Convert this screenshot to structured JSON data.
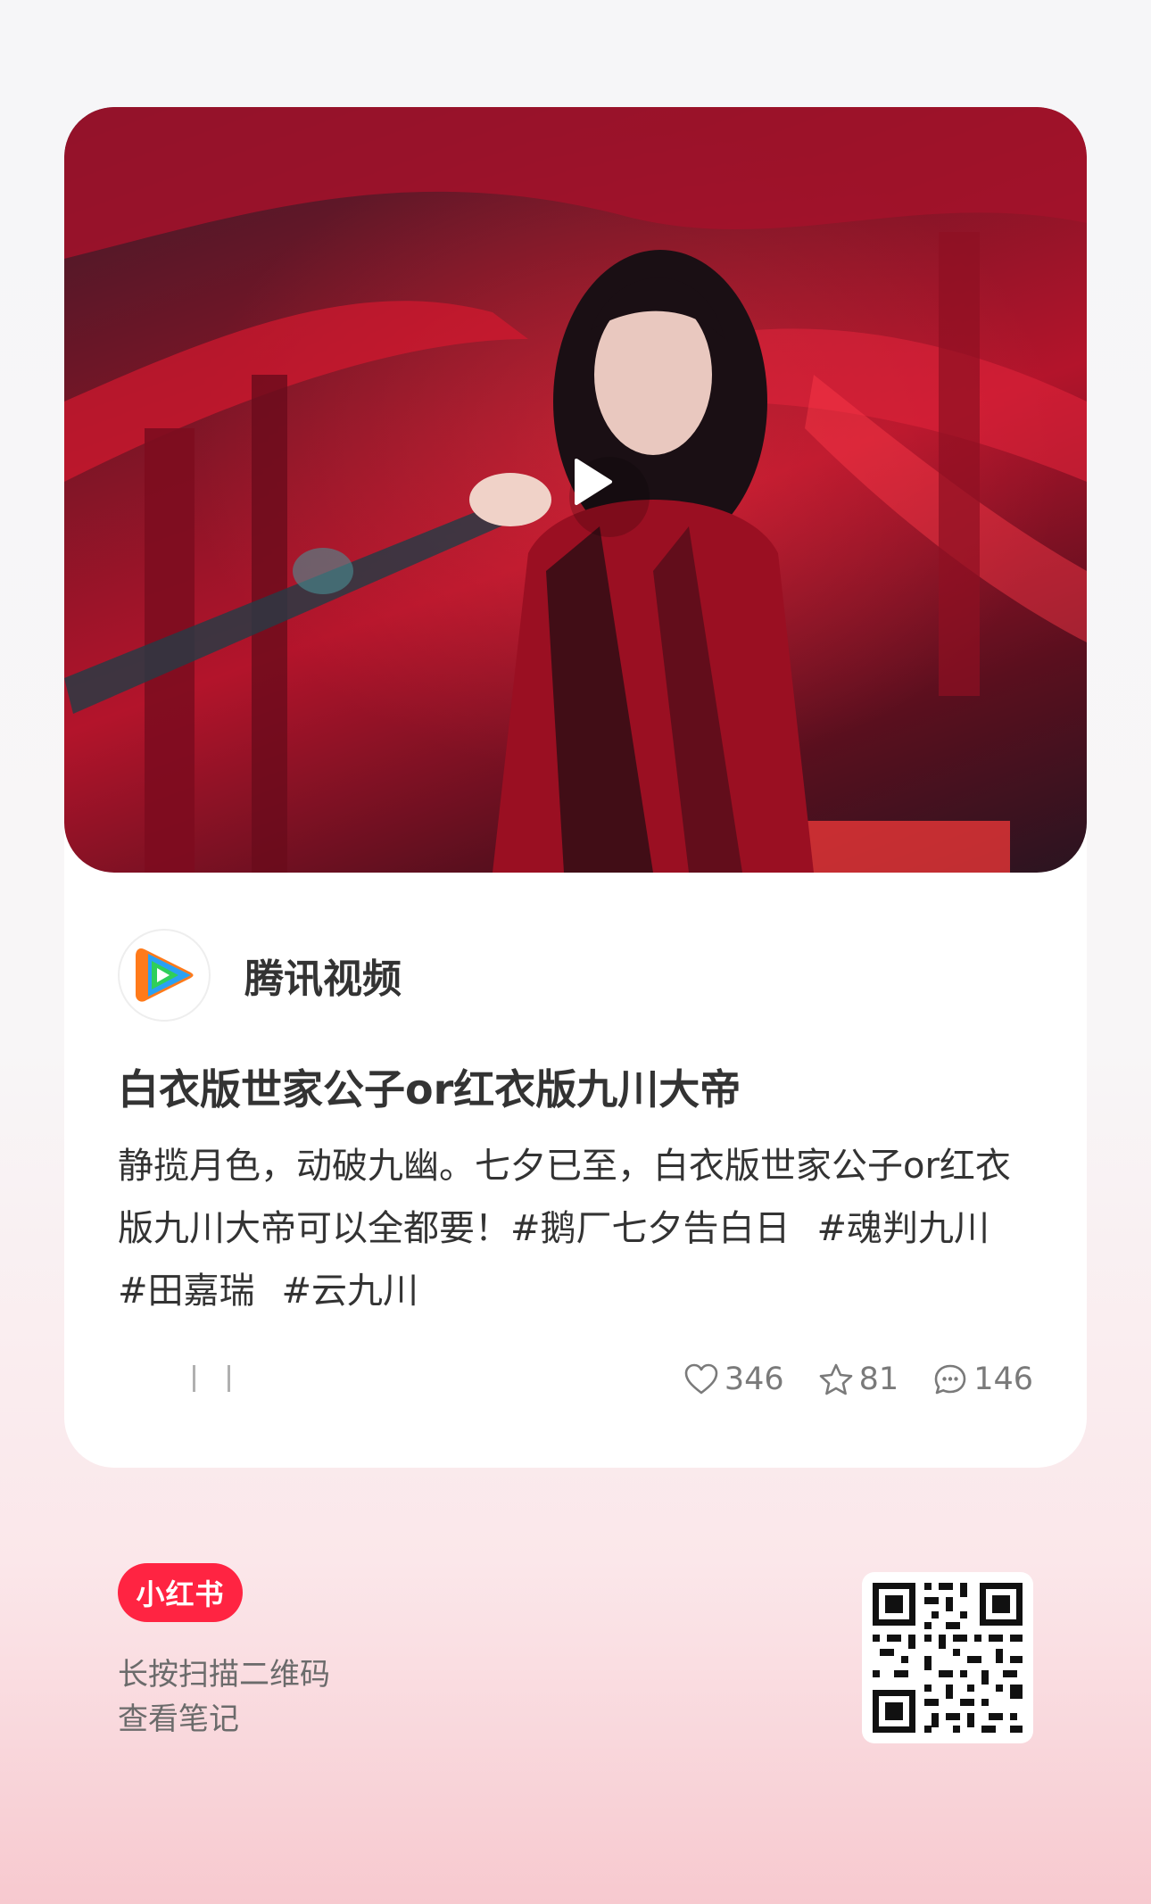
{
  "card": {
    "cover_description_icon": "play-icon",
    "author": {
      "name": "腾讯视频",
      "avatar_icon": "tencent-video-logo"
    },
    "title": "白衣版世家公子or红衣版九川大帝",
    "description": {
      "text": "静揽月色，动破九幽。七夕已至，白衣版世家公子or红衣版九川大帝可以全都要！",
      "tags": [
        "#鹅厂七夕告白日",
        "#魂判九川",
        "#田嘉瑞",
        "#云九川"
      ]
    },
    "stats": {
      "likes": "346",
      "collects": "81",
      "comments": "146"
    }
  },
  "footer": {
    "brand": "小红书",
    "hint_line1": "长按扫描二维码",
    "hint_line2": "查看笔记"
  },
  "colors": {
    "brand": "#ff2442",
    "text_primary": "#333333",
    "text_secondary": "#7a7a7a"
  }
}
